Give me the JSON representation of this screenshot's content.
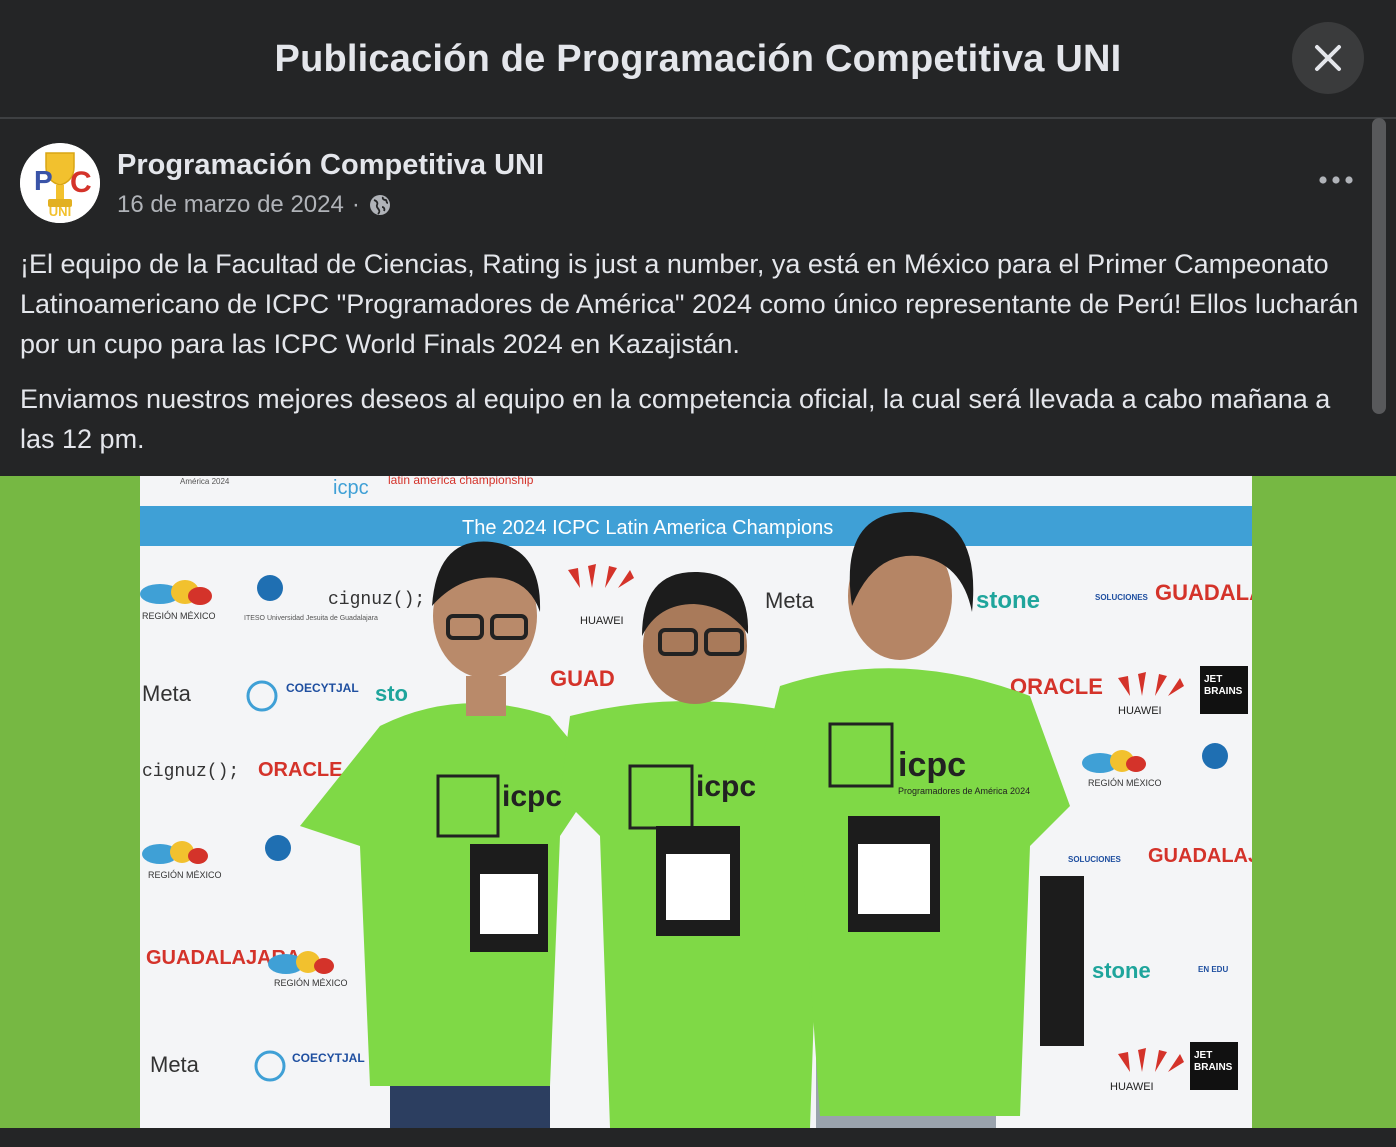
{
  "header": {
    "title": "Publicación de Programación Competitiva UNI"
  },
  "icons": {
    "close": "close-icon",
    "more": "more-horizontal-icon",
    "audience": "globe-icon"
  },
  "post": {
    "page_name": "Programación Competitiva UNI",
    "date": "16 de marzo de 2024",
    "separator": "·",
    "paragraphs": [
      "¡El equipo de la Facultad de Ciencias, Rating is just a number, ya está en México para el Primer Campeonato Latinoamericano de ICPC \"Programadores de América\" 2024 como único representante de Perú! Ellos lucharán por un cupo para las ICPC World Finals 2024 en Kazajistán.",
      "Enviamos nuestros mejores deseos al equipo en la competencia oficial, la cual será llevada a cabo mañana a las 12 pm."
    ]
  },
  "avatar": {
    "logo_text": "UNI",
    "letters": [
      "P",
      "C"
    ]
  },
  "photo": {
    "banner": "The 2024 ICPC Latin America Champions",
    "top_logo": "icpc",
    "top_logo_sub": "latin america championship",
    "america_label": "América 2024",
    "shirt_logo": "icpc",
    "shirt_sub": "Programadores de América 2024",
    "sponsors": {
      "huawei": "HUAWEI",
      "meta": "Meta",
      "oracle": "ORACLE",
      "cignuz": "cignuz();",
      "stone": "stone",
      "jetbrains_1": "JET",
      "jetbrains_2": "BRAINS",
      "region": "REGIÓN MÉXICO",
      "coecytjal": "COECYTJAL",
      "guadalajara_1": "GUADALAJARA",
      "guadalajara_2": "GUADALAJARA",
      "soluciones_1": "SOLUCIONES",
      "soluciones_2": "EN EDU",
      "iteso": "ITESO Universidad Jesuita de Guadalajara"
    },
    "colors": {
      "background": "#76b843",
      "shirt": "#7fd946",
      "banner": "#3fa0d6"
    }
  }
}
